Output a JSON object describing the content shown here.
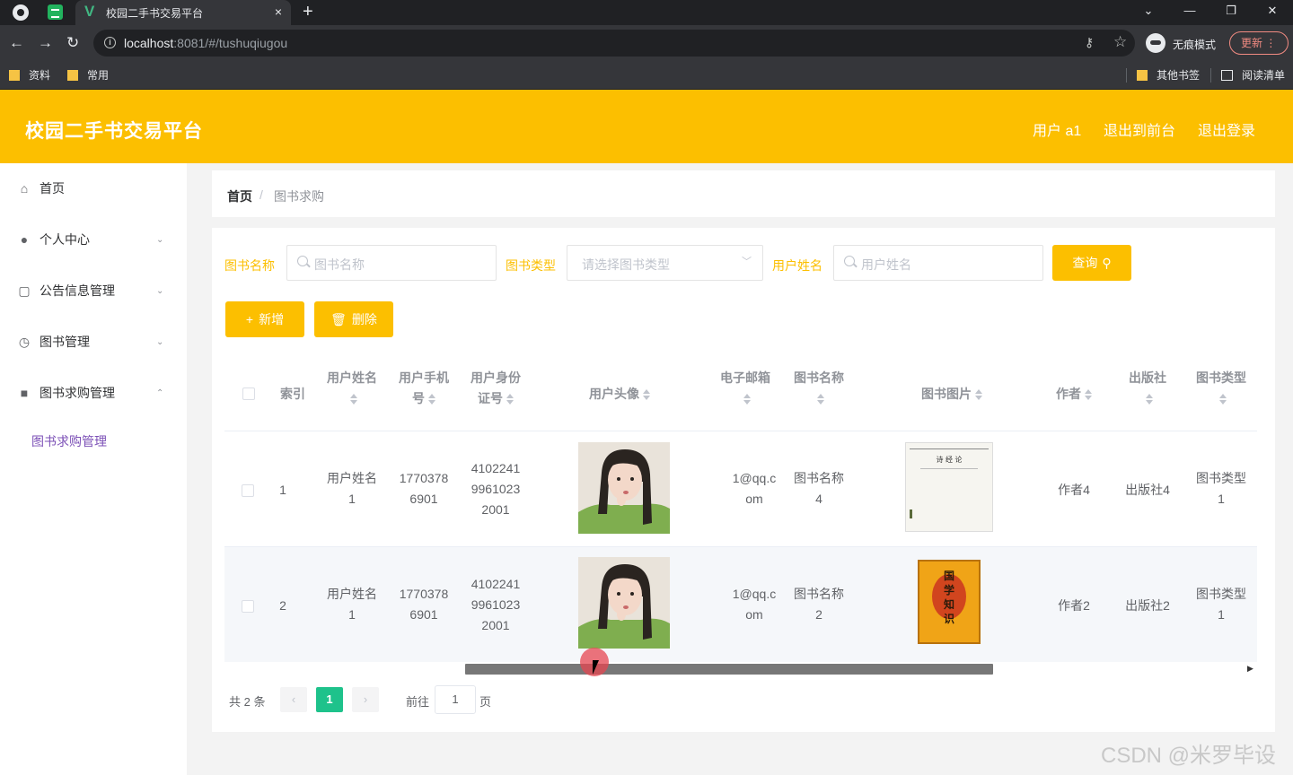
{
  "browser": {
    "tab_title": "校园二手书交易平台",
    "tab_close": "×",
    "new_tab": "+",
    "url_host": "localhost",
    "url_rest": ":8081/#/tushuqiugou",
    "incognito_label": "无痕模式",
    "update_label": "更新",
    "bookmarks": [
      "资料",
      "常用"
    ],
    "bookmarks_right": [
      "其他书签",
      "阅读清单"
    ]
  },
  "header": {
    "title": "校园二手书交易平台",
    "user": "用户 a1",
    "back_front": "退出到前台",
    "logout": "退出登录"
  },
  "sidebar": {
    "items": [
      {
        "label": "首页",
        "icon": "home-icon"
      },
      {
        "label": "个人中心",
        "icon": "user-icon"
      },
      {
        "label": "公告信息管理",
        "icon": "notice-icon"
      },
      {
        "label": "图书管理",
        "icon": "clock-icon"
      },
      {
        "label": "图书求购管理",
        "icon": "video-icon"
      }
    ],
    "sub_item": "图书求购管理"
  },
  "breadcrumb": {
    "home": "首页",
    "sep": "/",
    "current": "图书求购"
  },
  "filters": {
    "book_name_label": "图书名称",
    "book_name_placeholder": "图书名称",
    "book_type_label": "图书类型",
    "book_type_placeholder": "请选择图书类型",
    "user_name_label": "用户姓名",
    "user_name_placeholder": "用户姓名",
    "query_button": "查询"
  },
  "actions": {
    "add": "新增",
    "delete": "删除"
  },
  "table": {
    "headers": {
      "index": "索引",
      "user_name": [
        "用户姓名"
      ],
      "user_phone": [
        "用户手机",
        "号"
      ],
      "user_id": [
        "用户身份",
        "证号"
      ],
      "avatar": "用户头像",
      "email": [
        "电子邮箱"
      ],
      "book_name": [
        "图书名称"
      ],
      "book_image": "图书图片",
      "author": "作者",
      "publisher": [
        "出版社"
      ],
      "book_type": [
        "图书类型"
      ]
    },
    "rows": [
      {
        "index": "1",
        "user_name": [
          "用户姓名",
          "1"
        ],
        "phone": [
          "1770378",
          "6901"
        ],
        "id_no": [
          "4102241",
          "9961023",
          "2001"
        ],
        "email": [
          "1@qq.c",
          "om"
        ],
        "book_name": [
          "图书名称",
          "4"
        ],
        "author": "作者4",
        "publisher": "出版社4",
        "book_type": [
          "图书类型",
          "1"
        ],
        "book_cover_title": "诗 经 论"
      },
      {
        "index": "2",
        "user_name": [
          "用户姓名",
          "1"
        ],
        "phone": [
          "1770378",
          "6901"
        ],
        "id_no": [
          "4102241",
          "9961023",
          "2001"
        ],
        "email": [
          "1@qq.c",
          "om"
        ],
        "book_name": [
          "图书名称",
          "2"
        ],
        "author": "作者2",
        "publisher": "出版社2",
        "book_type": [
          "图书类型",
          "1"
        ],
        "book_cover_title": "国学知识"
      }
    ]
  },
  "pagination": {
    "total": "共 2 条",
    "current": "1",
    "prev": "‹",
    "next": "›",
    "goto": "前往",
    "goto_value": "1",
    "page_suffix": "页"
  },
  "watermark": "CSDN @米罗毕设",
  "colors": {
    "accent": "#fcbf00",
    "page_active": "#1ec28b",
    "submenu": "#7b4fb6"
  }
}
